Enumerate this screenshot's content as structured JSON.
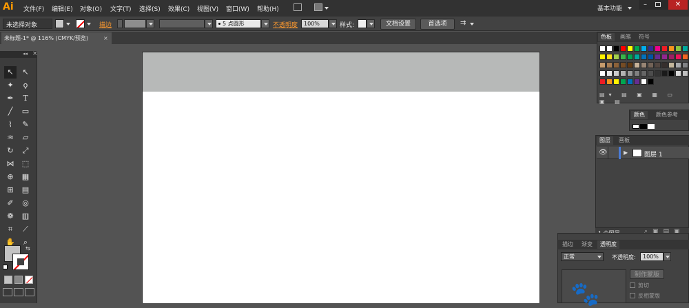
{
  "app": {
    "logo": "Ai",
    "workspace": "基本功能"
  },
  "menu": [
    "文件(F)",
    "编辑(E)",
    "对象(O)",
    "文字(T)",
    "选择(S)",
    "效果(C)",
    "视图(V)",
    "窗口(W)",
    "帮助(H)"
  ],
  "control": {
    "selection": "未选择对象",
    "stroke_label": "描边",
    "brush_value": "5 点圆形",
    "opacity_label": "不透明度",
    "opacity_value": "100%",
    "style_label": "样式:",
    "doc_setup": "文档设置",
    "prefs": "首选项"
  },
  "doc_tab": {
    "title": "未标题-1* @ 116% (CMYK/预览)",
    "close": "×"
  },
  "swatches": {
    "tabs": [
      "色板",
      "画笔",
      "符号"
    ],
    "colors": [
      [
        "#ffffff",
        "#ffffff",
        "#000000",
        "#ff0000",
        "#ffff00",
        "#00a651",
        "#00aeef",
        "#2e3192",
        "#ec008c",
        "#ed1c24",
        "#f7941d",
        "#8dc63f",
        "#00a99d"
      ],
      [
        "#fff200",
        "#ffde17",
        "#a3d04d",
        "#39b54a",
        "#00a651",
        "#00a99d",
        "#0072bc",
        "#0054a6",
        "#662d91",
        "#92278f",
        "#9e1f63",
        "#ed145b",
        "#f26522"
      ],
      [
        "#c69c6d",
        "#a67c52",
        "#8c6239",
        "#754c24",
        "#603913",
        "#c7b299",
        "#998675",
        "#736357",
        "#534741",
        "#362f2d",
        "#c2b59b",
        "#a7a9ac",
        "#808285"
      ],
      [
        "#ffffff",
        "#e6e6e6",
        "#cccccc",
        "#b3b3b3",
        "#999999",
        "#808080",
        "#666666",
        "#4d4d4d",
        "#333333",
        "#1a1a1a",
        "#000000",
        "#d9d9d9",
        "#bfbfbf"
      ],
      [
        "#ed1c24",
        "#f7941d",
        "#fff200",
        "#00a651",
        "#0072bc",
        "#662d91",
        "#ffffff",
        "#000000"
      ]
    ]
  },
  "color_panel": {
    "tabs": [
      "颜色",
      "颜色参考"
    ]
  },
  "layers": {
    "tabs": [
      "图层",
      "画板"
    ],
    "layer_name": "图层 1",
    "footer": "1 个图层"
  },
  "transparency": {
    "tabs": [
      "描边",
      "渐变",
      "透明度"
    ],
    "blend_mode": "正常",
    "opacity_label": "不透明度:",
    "opacity_value": "100%",
    "make_mask": "制作蒙版",
    "clip": "剪切",
    "invert_mask": "反相蒙版"
  }
}
